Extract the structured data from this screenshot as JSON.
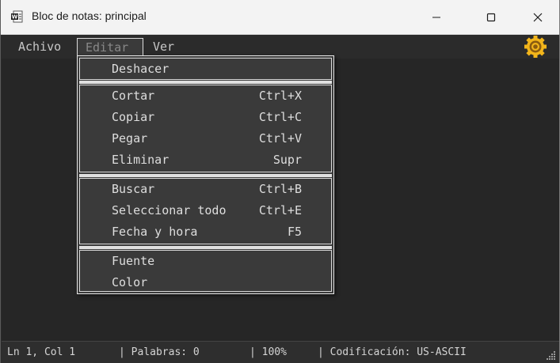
{
  "window": {
    "title": "Bloc de notas: principal",
    "app_icon": "word-document-icon"
  },
  "menubar": {
    "items": [
      {
        "label": "Achivo"
      },
      {
        "label": "Editar"
      },
      {
        "label": "Ver"
      }
    ],
    "settings_icon": "gear-icon",
    "accent_color": "#f2b51b"
  },
  "edit_menu": {
    "group1": [
      {
        "label": "Deshacer",
        "shortcut": ""
      }
    ],
    "group2": [
      {
        "label": "Cortar",
        "shortcut": "Ctrl+X"
      },
      {
        "label": "Copiar",
        "shortcut": "Ctrl+C"
      },
      {
        "label": "Pegar",
        "shortcut": "Ctrl+V"
      },
      {
        "label": "Eliminar",
        "shortcut": "Supr"
      }
    ],
    "group3": [
      {
        "label": "Buscar",
        "shortcut": "Ctrl+B"
      },
      {
        "label": "Seleccionar todo",
        "shortcut": "Ctrl+E"
      },
      {
        "label": "Fecha y hora",
        "shortcut": "F5"
      }
    ],
    "group4": [
      {
        "label": "Fuente",
        "shortcut": ""
      },
      {
        "label": "Color",
        "shortcut": ""
      }
    ]
  },
  "statusbar": {
    "position": "Ln 1, Col 1",
    "words": "| Palabras: 0",
    "zoom": "| 100%",
    "encoding": "| Codificación: US-ASCII"
  }
}
